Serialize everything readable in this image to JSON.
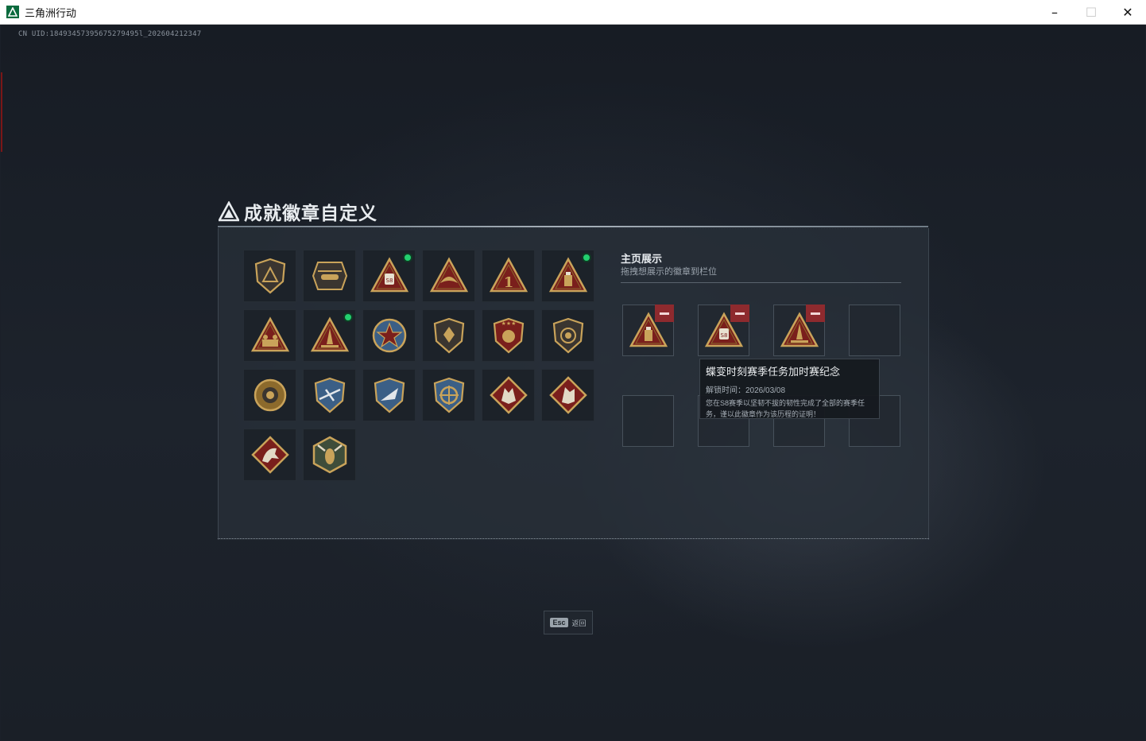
{
  "window": {
    "title": "三角洲行动",
    "controls": {
      "minimize": "–",
      "maximize": "☐",
      "close": "✕"
    }
  },
  "uid_text": "CN UID:18493457395675279495l_202604212347",
  "panel": {
    "title": "成就徽章自定义",
    "inventory": [
      {
        "icon": "shield-delta-badge-icon",
        "new": false
      },
      {
        "icon": "helicopter-badge-icon",
        "new": false
      },
      {
        "icon": "s8-season-triangle-badge-icon",
        "new": true
      },
      {
        "icon": "dove-triangle-badge-icon",
        "new": false
      },
      {
        "icon": "number-one-triangle-badge-icon",
        "new": false
      },
      {
        "icon": "flashlight-triangle-badge-icon",
        "new": true
      },
      {
        "icon": "soldiers-triangle-badge-icon",
        "new": false
      },
      {
        "icon": "rocket-triangle-badge-icon",
        "new": true
      },
      {
        "icon": "star-medal-badge-icon",
        "new": false
      },
      {
        "icon": "shield-emblem-badge-icon",
        "new": false
      },
      {
        "icon": "star-crest-badge-icon",
        "new": false
      },
      {
        "icon": "lion-shield-badge-icon",
        "new": false
      },
      {
        "icon": "rose-medallion-badge-icon",
        "new": false
      },
      {
        "icon": "aircraft-blue-crest-badge-icon",
        "new": false
      },
      {
        "icon": "jet-blue-crest-badge-icon",
        "new": false
      },
      {
        "icon": "compass-gold-crest-badge-icon",
        "new": false
      },
      {
        "icon": "wolf-diamond-badge-icon",
        "new": false
      },
      {
        "icon": "wolf-howl-diamond-badge-icon",
        "new": false
      },
      {
        "icon": "horse-diamond-badge-icon",
        "new": false
      },
      {
        "icon": "wasp-hexagon-badge-icon",
        "new": false
      }
    ],
    "showcase": {
      "title": "主页展示",
      "subtitle": "拖拽想展示的徽章到栏位",
      "slots": [
        {
          "icon": "flashlight-triangle-badge-icon",
          "filled": true
        },
        {
          "icon": "s8-season-triangle-badge-icon",
          "filled": true
        },
        {
          "icon": "rocket-triangle-badge-icon",
          "filled": true
        },
        {
          "icon": "",
          "filled": false
        },
        {
          "icon": "",
          "filled": false
        },
        {
          "icon": "",
          "filled": false
        },
        {
          "icon": "",
          "filled": false
        },
        {
          "icon": "",
          "filled": false
        }
      ]
    },
    "tooltip": {
      "title": "蝶变时刻赛季任务加时赛纪念",
      "unlock_time": "解锁时间：2026/03/08",
      "description": "您在S8赛季以坚韧不拔的韧性完成了全部的赛季任务，谨以此徽章作为该历程的证明！"
    }
  },
  "esc_back": {
    "key": "Esc",
    "label": "返回"
  },
  "colors": {
    "accent_gold": "#c9a35a",
    "badge_red": "#7a1f1c",
    "new_dot": "#23d06f",
    "remove_red": "#8e2a2e"
  }
}
